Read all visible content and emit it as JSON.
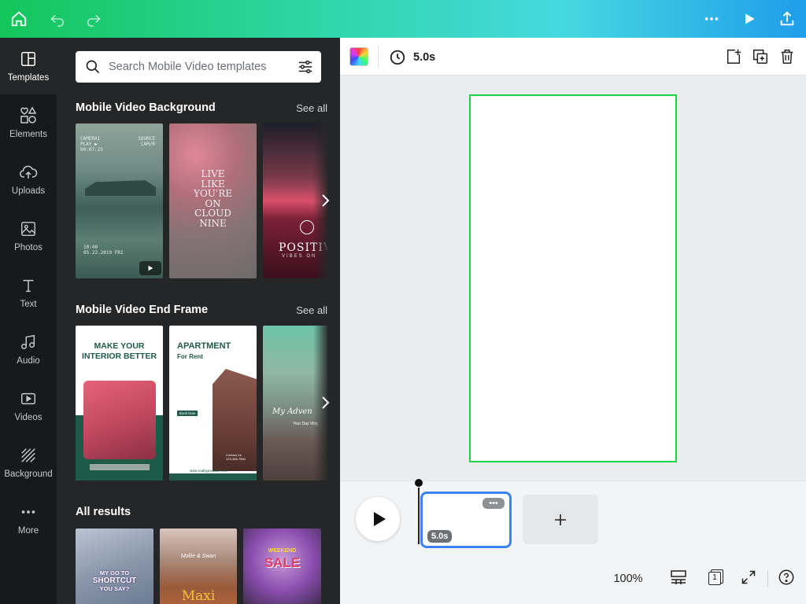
{
  "colors": {
    "rail_bg": "#18191b",
    "panel_bg": "#252627",
    "accent_green": "#19d248",
    "clip_border": "#3b82f6"
  },
  "topbar": {
    "icons": [
      "home-icon",
      "undo-icon",
      "redo-icon",
      "more-icon",
      "play-icon",
      "share-icon"
    ]
  },
  "rail": {
    "items": [
      {
        "label": "Templates",
        "icon": "templates-icon",
        "active": true
      },
      {
        "label": "Elements",
        "icon": "elements-icon"
      },
      {
        "label": "Uploads",
        "icon": "uploads-icon"
      },
      {
        "label": "Photos",
        "icon": "photos-icon"
      },
      {
        "label": "Text",
        "icon": "text-icon"
      },
      {
        "label": "Audio",
        "icon": "audio-icon"
      },
      {
        "label": "Videos",
        "icon": "videos-icon"
      },
      {
        "label": "Background",
        "icon": "background-icon"
      },
      {
        "label": "More",
        "icon": "more-icon"
      }
    ]
  },
  "panel": {
    "search_placeholder": "Search Mobile Video templates",
    "sections": [
      {
        "title": "Mobile Video Background",
        "see_all": "See all",
        "thumbs": [
          {
            "lines": [
              "CAMERA1",
              "PLAY ▶",
              "00:07:23",
              "SOURCE",
              "CAM/R",
              "10:40",
              "05.22.2019 FRI"
            ]
          },
          {
            "lines": [
              "LIVE",
              "LIKE",
              "YOU'RE",
              "ON",
              "CLOUD",
              "NINE"
            ]
          },
          {
            "lines": [
              "POSITIV",
              "VIBES ON"
            ]
          }
        ]
      },
      {
        "title": "Mobile Video End Frame",
        "see_all": "See all",
        "thumbs": [
          {
            "lines": [
              "MAKE YOUR",
              "INTERIOR BETTER"
            ]
          },
          {
            "lines": [
              "APARTMENT",
              "For Rent",
              "Book Now",
              "Contact Us",
              "123-456-7890",
              "www.reallygreatsite.com"
            ]
          },
          {
            "lines": [
              "My Adven",
              "Your Day Vlog"
            ]
          }
        ]
      },
      {
        "title": "All results",
        "thumbs": [
          {
            "lines": [
              "MY GO TO",
              "SHORTCUT",
              "YOU SAY?"
            ]
          },
          {
            "lines": [
              "Mollie & Swan",
              "Maxi"
            ]
          },
          {
            "lines": [
              "WEEKEND",
              "SALE"
            ]
          }
        ]
      }
    ]
  },
  "toolbar": {
    "duration": "5.0s"
  },
  "timeline": {
    "clip_duration": "5.0s",
    "clip_more": "•••"
  },
  "footer": {
    "zoom": "100%",
    "page_count": "1"
  }
}
